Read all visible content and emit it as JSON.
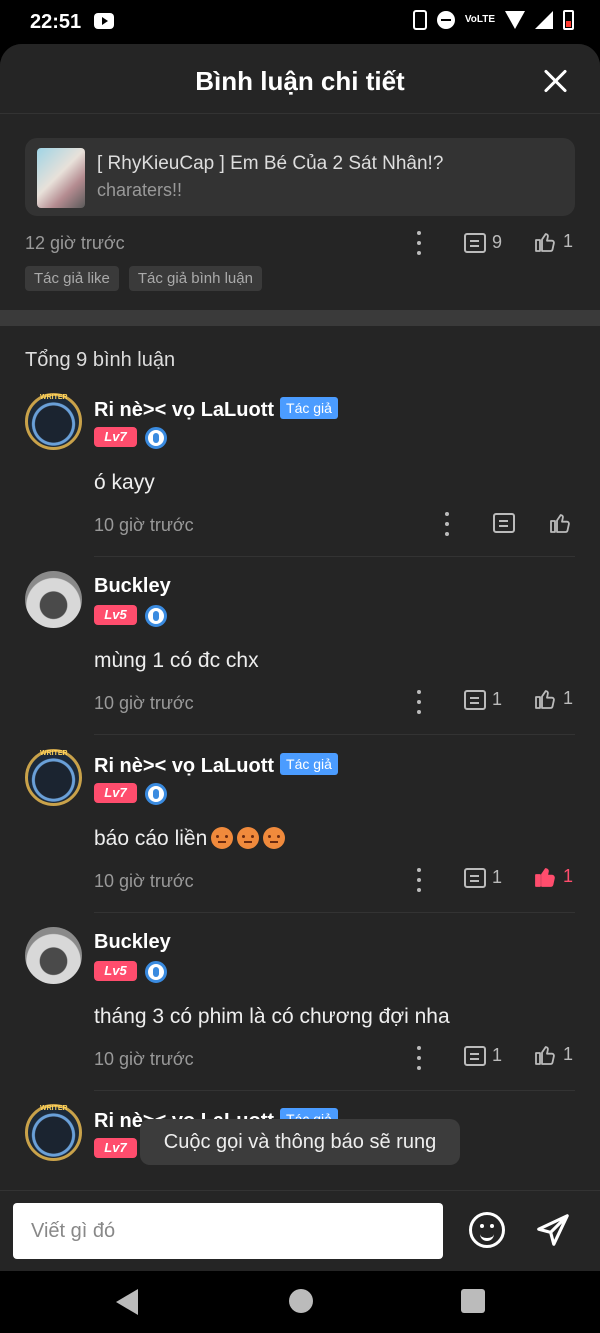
{
  "status_bar": {
    "time": "22:51",
    "network": "VoLTE"
  },
  "header": {
    "title": "Bình luận chi tiết"
  },
  "post": {
    "title": "[ RhyKieuCap ] Em Bé Của 2 Sát Nhân!?",
    "subtitle": "charaters!!",
    "time": "12 giờ trước",
    "comments": "9",
    "likes": "1",
    "tags": [
      "Tác giả like",
      "Tác giả bình luận"
    ]
  },
  "comments_section": {
    "total_label": "Tổng 9 bình luận",
    "items": [
      {
        "name": "Ri nè>< vọ LaLuott",
        "author_badge": "Tác giả",
        "level": "Lv7",
        "text": "ó kayy",
        "time": "10 giờ trước",
        "reply_count": "",
        "like_count": "",
        "liked": false
      },
      {
        "name": "Buckley",
        "author_badge": "",
        "level": "Lv5",
        "text": "mùng 1 có đc chx",
        "time": "10 giờ trước",
        "reply_count": "1",
        "like_count": "1",
        "liked": false
      },
      {
        "name": "Ri nè>< vọ LaLuott",
        "author_badge": "Tác giả",
        "level": "Lv7",
        "text": "báo cáo liền",
        "emoji_count": 3,
        "time": "10 giờ trước",
        "reply_count": "1",
        "like_count": "1",
        "liked": true
      },
      {
        "name": "Buckley",
        "author_badge": "",
        "level": "Lv5",
        "text": "tháng 3 có phim là có chương đợi nha",
        "time": "10 giờ trước",
        "reply_count": "1",
        "like_count": "1",
        "liked": false
      },
      {
        "name": "Ri nè>< vọ LaLuott",
        "author_badge": "Tác giả",
        "level": "Lv7"
      }
    ]
  },
  "toast": "Cuộc gọi và thông báo sẽ rung",
  "composer": {
    "placeholder": "Viết gì đó"
  },
  "colors": {
    "sheet": "#252525",
    "accent_badge": "#4b9cff",
    "level_badge": "#ff4d6d",
    "liked": "#ff4d6d"
  }
}
